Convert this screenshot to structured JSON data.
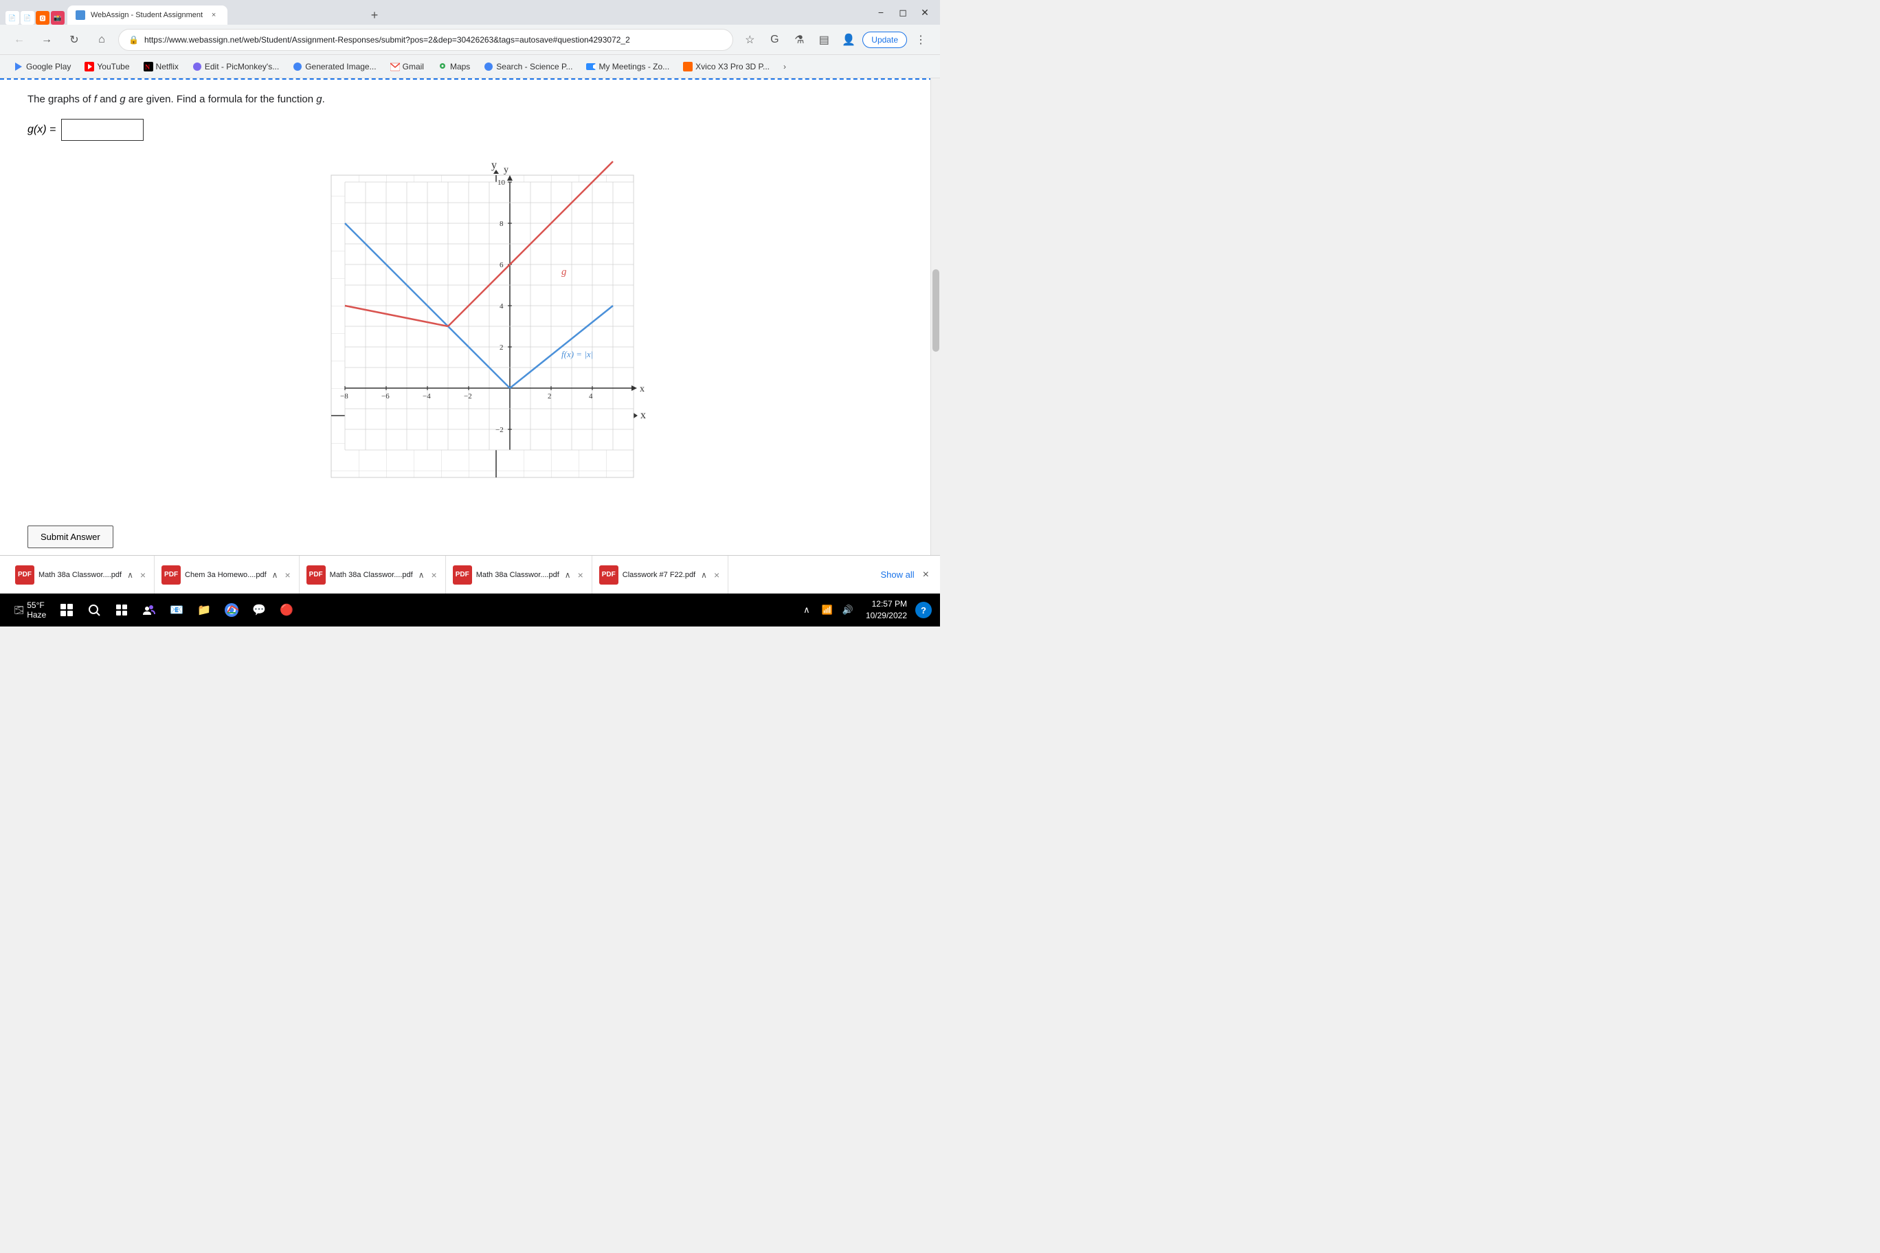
{
  "browser": {
    "tab_title": "WebAssign - Student Assignment",
    "address": "https://www.webassign.net/web/Student/Assignment-Responses/submit?pos=2&dep=30426263&tags=autosave#question4293072_2",
    "update_btn": "Update",
    "nav_back_disabled": false,
    "nav_forward_disabled": true
  },
  "bookmarks": [
    {
      "label": "Google Play",
      "color": "#4285f4"
    },
    {
      "label": "YouTube",
      "color": "#ff0000"
    },
    {
      "label": "Netflix",
      "color": "#e50914"
    },
    {
      "label": "Edit - PicMonkey's...",
      "color": "#7b68ee"
    },
    {
      "label": "Generated Image...",
      "color": "#4285f4"
    },
    {
      "label": "Gmail",
      "color": "#ea4335"
    },
    {
      "label": "Maps",
      "color": "#34a853"
    },
    {
      "label": "Search - Science P...",
      "color": "#4285f4"
    },
    {
      "label": "My Meetings - Zo...",
      "color": "#2d8cff"
    },
    {
      "label": "Xvico X3 Pro 3D P...",
      "color": "#ff6600"
    }
  ],
  "question": {
    "text": "The graphs of f and g are given. Find a formula for the function g.",
    "label": "g(x) =",
    "input_placeholder": "",
    "input_value": ""
  },
  "graph": {
    "x_label": "x",
    "y_label": "y",
    "f_label": "f(x) = |x|",
    "g_label": "g",
    "x_ticks": [
      "-8",
      "-6",
      "-4",
      "-2",
      "2",
      "4"
    ],
    "y_ticks": [
      "-2",
      "2",
      "4",
      "6",
      "8",
      "10"
    ]
  },
  "submit_btn": "Submit Answer",
  "downloads": [
    {
      "name": "Math 38a Classwor....pdf"
    },
    {
      "name": "Chem 3a Homewo....pdf"
    },
    {
      "name": "Math 38a Classwor....pdf"
    },
    {
      "name": "Math 38a Classwor....pdf"
    },
    {
      "name": "Classwork #7 F22.pdf"
    }
  ],
  "show_all": "Show all",
  "taskbar": {
    "weather_temp": "55°F",
    "weather_desc": "Haze",
    "time": "12:57 PM",
    "date": "10/29/2022"
  }
}
